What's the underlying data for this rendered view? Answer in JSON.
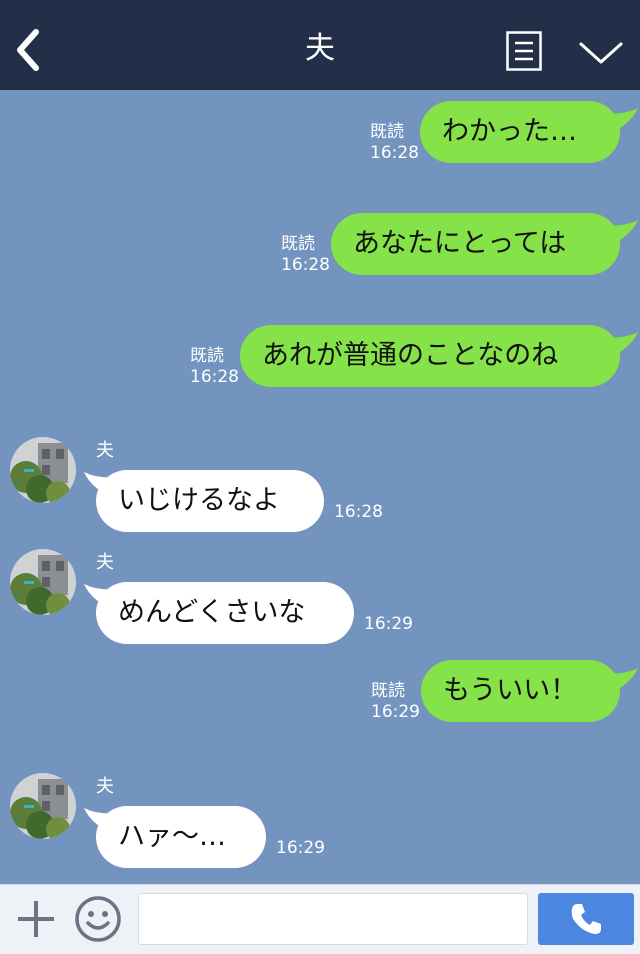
{
  "header": {
    "title": "夫",
    "icons": [
      "back-arrow-icon",
      "menu-list-icon",
      "chevron-down-icon"
    ]
  },
  "messages": [
    {
      "direction": "out",
      "text": "わかった…",
      "read_label": "既読",
      "time": "16:28"
    },
    {
      "direction": "out",
      "text": "あなたにとっては",
      "read_label": "既読",
      "time": "16:28"
    },
    {
      "direction": "out",
      "text": "あれが普通のことなのね",
      "read_label": "既読",
      "time": "16:28"
    },
    {
      "direction": "in",
      "sender": "夫",
      "text": "いじけるなよ",
      "time": "16:28"
    },
    {
      "direction": "in",
      "sender": "夫",
      "text": "めんどくさいな",
      "time": "16:29"
    },
    {
      "direction": "out",
      "text": "もういい！",
      "read_label": "既読",
      "time": "16:29"
    },
    {
      "direction": "in",
      "sender": "夫",
      "text": "ハァ〜…",
      "time": "16:29"
    }
  ],
  "footer": {
    "input_value": "",
    "icons": [
      "plus-icon",
      "emoji-icon",
      "phone-icon"
    ]
  },
  "colors": {
    "header_bg": "#232e49",
    "chat_bg": "#7494c0",
    "outgoing_bubble": "#85e249",
    "incoming_bubble": "#ffffff",
    "call_button": "#4b86e0"
  }
}
